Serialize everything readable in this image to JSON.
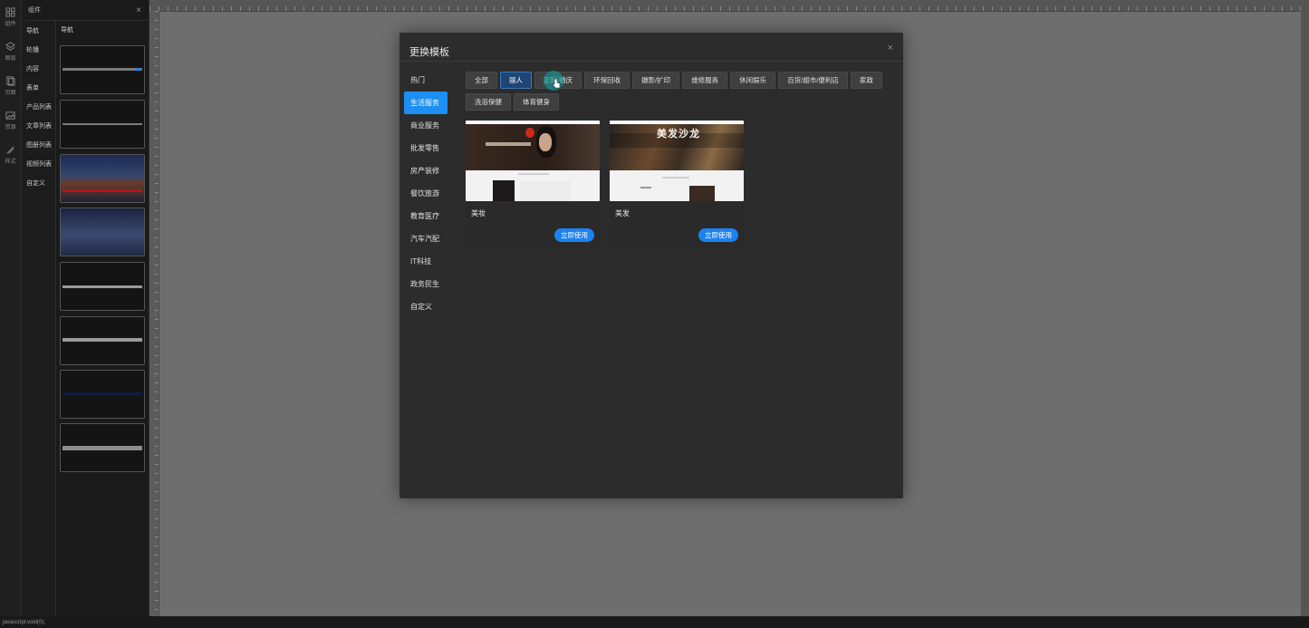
{
  "sidebar": {
    "rail": [
      {
        "label": "组件",
        "icon": "grid-icon"
      },
      {
        "label": "图层",
        "icon": "layers-icon"
      },
      {
        "label": "页面",
        "icon": "page-icon"
      },
      {
        "label": "资源",
        "icon": "image-icon"
      },
      {
        "label": "样式",
        "icon": "brush-icon"
      }
    ],
    "categories": [
      "导航",
      "轮播",
      "内容",
      "表单",
      "产品列表",
      "文章列表",
      "图册列表",
      "视频列表",
      "自定义"
    ],
    "panel_title": "组件",
    "panel_sub": "导航"
  },
  "modal": {
    "title": "更换模板",
    "close": "×",
    "side": [
      "热门",
      "生活服务",
      "商业服务",
      "批发零售",
      "房产装修",
      "餐饮旅游",
      "教育医疗",
      "汽车汽配",
      "IT科技",
      "政务民生",
      "自定义"
    ],
    "tags": [
      "全部",
      "丽人",
      "定制/婚庆",
      "环保回收",
      "摄影/扩印",
      "维修服务",
      "休闲娱乐",
      "百货/超市/便利店",
      "家政",
      "洗浴保健",
      "体育健身"
    ],
    "cards": [
      {
        "name": "美妆",
        "button": "立即使用"
      },
      {
        "name": "美发",
        "button": "立即使用",
        "banner_text": "美发沙龙"
      }
    ]
  },
  "status_text": "javascript:void(0);",
  "colors": {
    "accent": "#1d8ff2",
    "tag_active": "#1f4574",
    "modal_bg": "#2c2c2c"
  }
}
